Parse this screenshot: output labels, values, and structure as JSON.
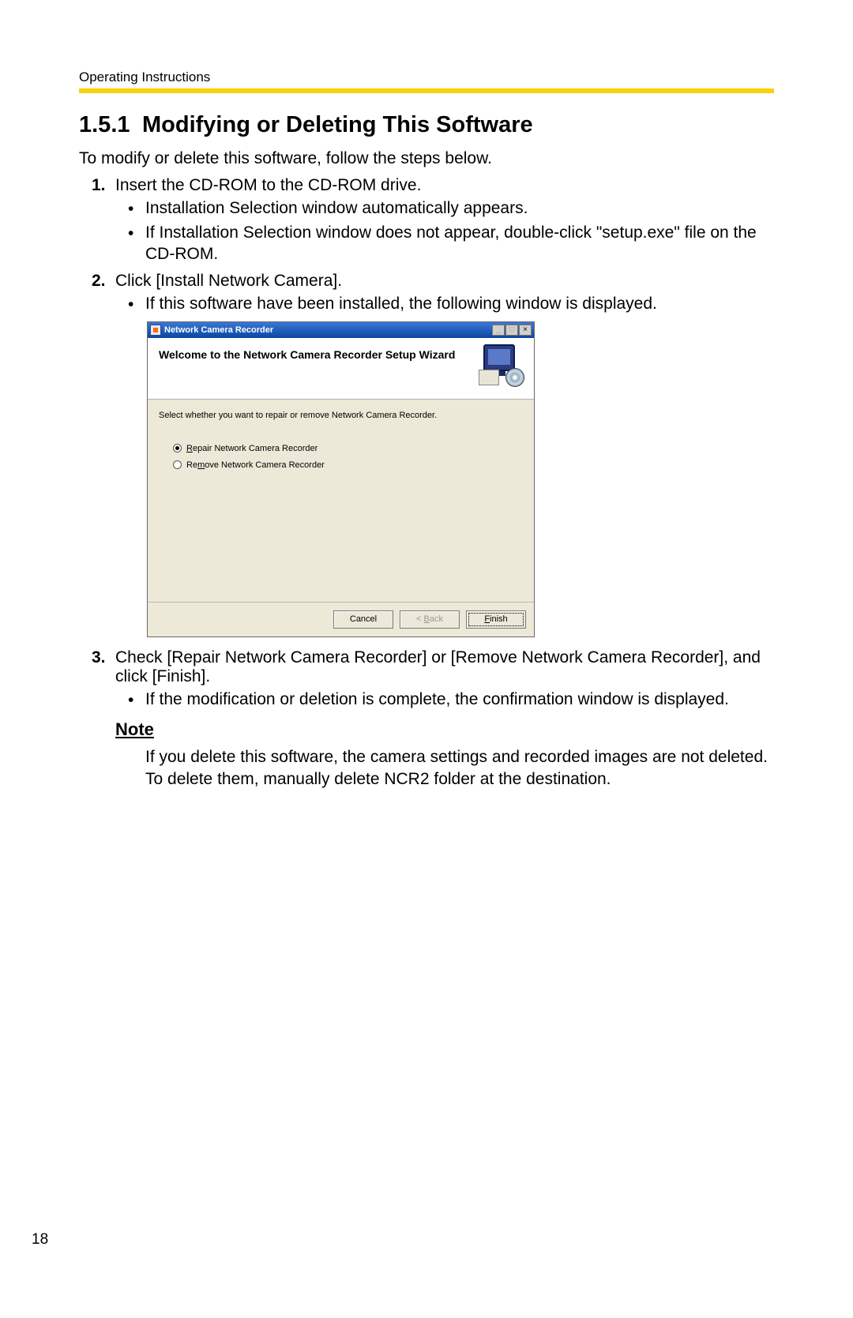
{
  "header": "Operating Instructions",
  "section": {
    "number": "1.5.1",
    "title": "Modifying or Deleting This Software"
  },
  "intro": "To modify or delete this software, follow the steps below.",
  "steps": [
    {
      "n": "1.",
      "text": "Insert the CD-ROM to the CD-ROM drive.",
      "bullets": [
        "Installation Selection window automatically appears.",
        "If Installation Selection window does not appear, double-click \"setup.exe\" file on the CD-ROM."
      ]
    },
    {
      "n": "2.",
      "text": "Click [Install Network Camera].",
      "bullets": [
        "If this software have been installed, the following window is displayed."
      ]
    },
    {
      "n": "3.",
      "text": "Check [Repair Network Camera Recorder] or [Remove Network Camera Recorder], and click [Finish].",
      "bullets": [
        "If the modification or deletion is complete, the confirmation window is displayed."
      ]
    }
  ],
  "note": {
    "heading": "Note",
    "body": "If you delete this software, the camera settings and recorded images are not deleted. To delete them, manually delete NCR2 folder at the destination."
  },
  "wizard": {
    "title": "Network Camera Recorder",
    "welcome": "Welcome to the Network Camera Recorder Setup Wizard",
    "select_text": "Select whether you want to repair or remove Network Camera Recorder.",
    "radios": [
      {
        "label_pre": "R",
        "label_rest": "epair Network Camera Recorder",
        "selected": true
      },
      {
        "label_pre": "Re",
        "label_u": "m",
        "label_rest": "ove Network Camera Recorder",
        "selected": false
      }
    ],
    "buttons": {
      "cancel": "Cancel",
      "back_pre": "< ",
      "back_u": "B",
      "back_rest": "ack",
      "finish_u": "F",
      "finish_rest": "inish"
    },
    "sysbuttons": {
      "min": "_",
      "max": "□",
      "close": "×"
    }
  },
  "page_number": "18"
}
